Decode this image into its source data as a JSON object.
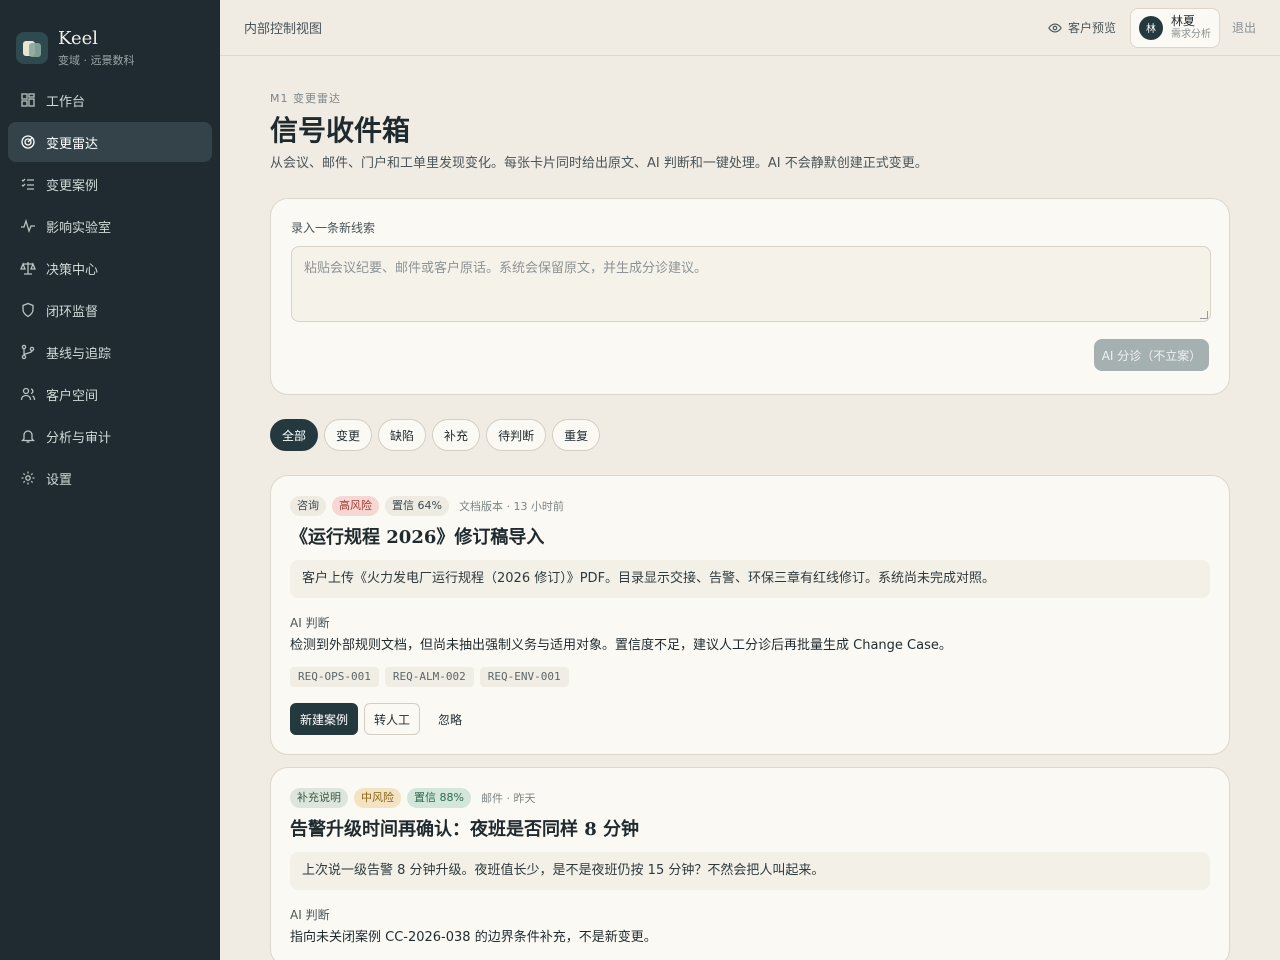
{
  "brand": {
    "name": "Keel",
    "subtitle": "变域 · 远景数科"
  },
  "sidebar": {
    "items": [
      {
        "label": "工作台",
        "icon": "dashboard-icon"
      },
      {
        "label": "变更雷达",
        "icon": "radar-icon",
        "active": true
      },
      {
        "label": "变更案例",
        "icon": "checklist-icon"
      },
      {
        "label": "影响实验室",
        "icon": "pulse-icon"
      },
      {
        "label": "决策中心",
        "icon": "scale-icon"
      },
      {
        "label": "闭环监督",
        "icon": "shield-icon"
      },
      {
        "label": "基线与追踪",
        "icon": "branch-icon"
      },
      {
        "label": "客户空间",
        "icon": "users-icon"
      },
      {
        "label": "分析与审计",
        "icon": "bell-icon"
      },
      {
        "label": "设置",
        "icon": "gear-icon"
      }
    ]
  },
  "topbar": {
    "title": "内部控制视图",
    "preview_label": "客户预览",
    "user": {
      "initial": "林",
      "name": "林夏",
      "role": "需求分析"
    },
    "logout_label": "退出"
  },
  "header": {
    "eyebrow": "M1 变更雷达",
    "title": "信号收件箱",
    "description": "从会议、邮件、门户和工单里发现变化。每张卡片同时给出原文、AI 判断和一键处理。AI 不会静默创建正式变更。"
  },
  "compose": {
    "label": "录入一条新线索",
    "placeholder": "粘贴会议纪要、邮件或客户原话。系统会保留原文，并生成分诊建议。",
    "submit_label": "AI 分诊（不立案）"
  },
  "filters": [
    "全部",
    "变更",
    "缺陷",
    "补充",
    "待判断",
    "重复"
  ],
  "cards": [
    {
      "type_tag": "咨询",
      "risk_tag": "高风险",
      "confidence_tag": "置信 64%",
      "meta": "文档版本 · 13 小时前",
      "title": "《运行规程 2026》修订稿导入",
      "quote": "客户上传《火力发电厂运行规程（2026 修订）》PDF。目录显示交接、告警、环保三章有红线修订。系统尚未完成对照。",
      "ai_label": "AI 判断",
      "ai_text": "检测到外部规则文档，但尚未抽出强制义务与适用对象。置信度不足，建议人工分诊后再批量生成 Change Case。",
      "reqs": [
        "REQ-OPS-001",
        "REQ-ALM-002",
        "REQ-ENV-001"
      ],
      "actions": {
        "primary": "新建案例",
        "secondary": "转人工",
        "ghost": "忽略"
      }
    },
    {
      "type_tag": "补充说明",
      "risk_tag": "中风险",
      "confidence_tag": "置信 88%",
      "meta": "邮件 · 昨天",
      "title": "告警升级时间再确认：夜班是否同样 8 分钟",
      "quote": "上次说一级告警 8 分钟升级。夜班值长少，是不是夜班仍按 15 分钟？不然会把人叫起来。",
      "ai_label": "AI 判断",
      "ai_text": "指向未关闭案例 CC-2026-038 的边界条件补充，不是新变更。"
    }
  ]
}
